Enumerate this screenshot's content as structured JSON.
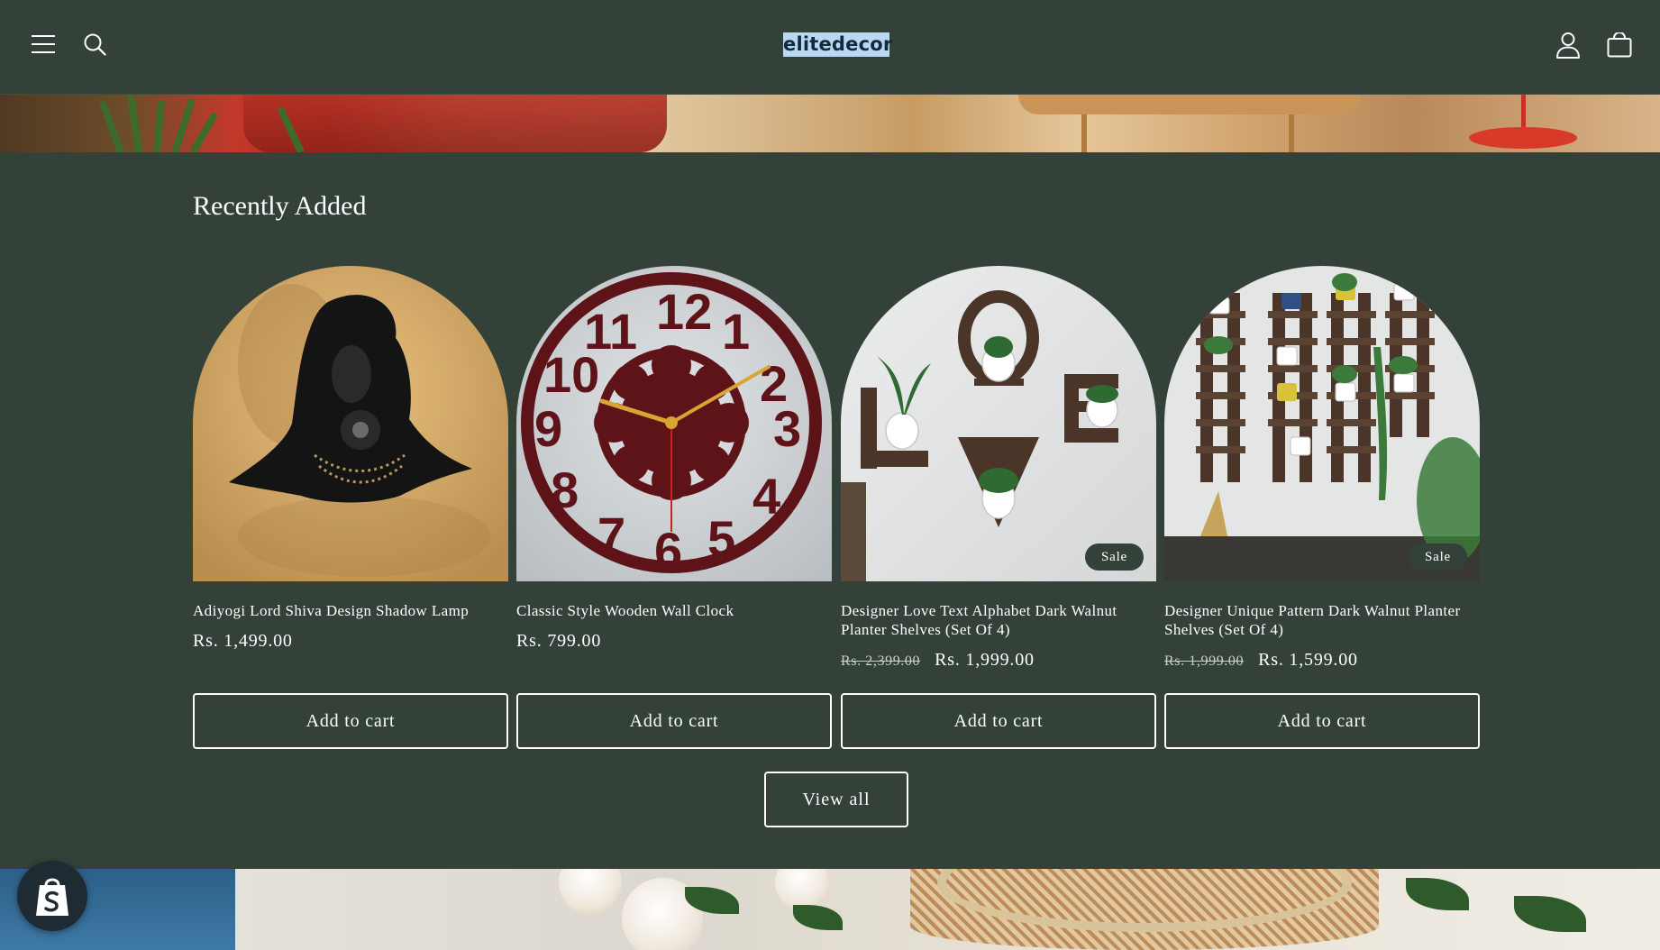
{
  "header": {
    "logo_text": "elitedecor",
    "icons": [
      "menu-icon",
      "search-icon",
      "account-icon",
      "cart-icon"
    ]
  },
  "section": {
    "title": "Recently Added"
  },
  "products": [
    {
      "title": "Adiyogi Lord Shiva Design Shadow Lamp",
      "price": "Rs. 1,499.00",
      "compare_price": "",
      "badge": "",
      "button_label": "Add to cart"
    },
    {
      "title": "Classic Style Wooden Wall Clock",
      "price": "Rs. 799.00",
      "compare_price": "",
      "badge": "",
      "button_label": "Add to cart"
    },
    {
      "title": "Designer Love Text Alphabet Dark Walnut Planter Shelves (Set Of 4)",
      "price": "Rs. 1,999.00",
      "compare_price": "Rs. 2,399.00",
      "badge": "Sale",
      "button_label": "Add to cart"
    },
    {
      "title": "Designer Unique Pattern Dark Walnut Planter Shelves (Set Of 4)",
      "price": "Rs. 1,599.00",
      "compare_price": "Rs. 1,999.00",
      "badge": "Sale",
      "button_label": "Add to cart"
    }
  ],
  "view_all_label": "View all",
  "colors": {
    "background": "#334139",
    "text": "#ffffff",
    "logo_bg": "#b9d8f4"
  }
}
